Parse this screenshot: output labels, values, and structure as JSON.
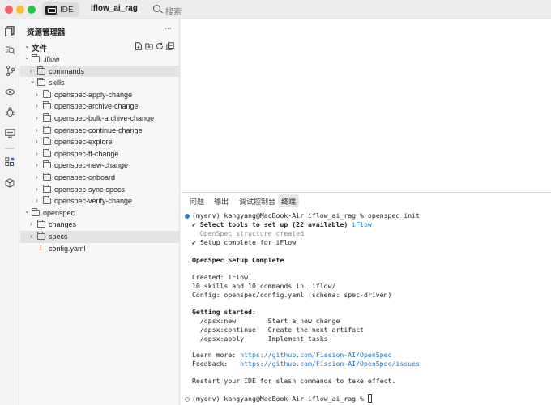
{
  "titlebar": {
    "ide_label": "IDE",
    "project": "iflow_ai_rag",
    "search_placeholder": "搜索"
  },
  "sidebar": {
    "title": "资源管理器",
    "more": "···",
    "section": "文件",
    "tree": [
      {
        "label": ".iflow",
        "depth": 0,
        "expanded": true,
        "type": "folder"
      },
      {
        "label": "commands",
        "depth": 1,
        "expanded": false,
        "type": "folder",
        "selected": true
      },
      {
        "label": "skills",
        "depth": 1,
        "expanded": true,
        "type": "folder"
      },
      {
        "label": "openspec-apply-change",
        "depth": 2,
        "expanded": false,
        "type": "folder"
      },
      {
        "label": "openspec-archive-change",
        "depth": 2,
        "expanded": false,
        "type": "folder"
      },
      {
        "label": "openspec-bulk-archive-change",
        "depth": 2,
        "expanded": false,
        "type": "folder"
      },
      {
        "label": "openspec-continue-change",
        "depth": 2,
        "expanded": false,
        "type": "folder"
      },
      {
        "label": "openspec-explore",
        "depth": 2,
        "expanded": false,
        "type": "folder"
      },
      {
        "label": "openspec-ff-change",
        "depth": 2,
        "expanded": false,
        "type": "folder"
      },
      {
        "label": "openspec-new-change",
        "depth": 2,
        "expanded": false,
        "type": "folder"
      },
      {
        "label": "openspec-onboard",
        "depth": 2,
        "expanded": false,
        "type": "folder"
      },
      {
        "label": "openspec-sync-specs",
        "depth": 2,
        "expanded": false,
        "type": "folder"
      },
      {
        "label": "openspec-verify-change",
        "depth": 2,
        "expanded": false,
        "type": "folder"
      },
      {
        "label": "openspec",
        "depth": 0,
        "expanded": true,
        "type": "folder"
      },
      {
        "label": "changes",
        "depth": 1,
        "expanded": false,
        "type": "folder"
      },
      {
        "label": "specs",
        "depth": 1,
        "expanded": false,
        "type": "folder",
        "selected": true
      },
      {
        "label": "config.yaml",
        "depth": 1,
        "type": "yaml"
      }
    ]
  },
  "panel": {
    "tabs": [
      "问题",
      "输出",
      "调试控制台",
      "终端"
    ],
    "active_tab": "终端"
  },
  "terminal": {
    "prompt1": "(myenv) kangyang@MacBook-Air iflow_ai_rag % openspec init",
    "select_prefix": "✔ Select tools to set up (22 available) ",
    "select_value": "iFlow",
    "structure": "  OpenSpec structure created",
    "setup": "✔ Setup complete for iFlow",
    "heading": "OpenSpec Setup Complete",
    "created": "Created: iFlow",
    "skills": "10 skills and 10 commands in .iflow/",
    "config": "Config: openspec/config.yaml (schema: spec-driven)",
    "getting_started": "Getting started:",
    "cmd1": "  /opsx:new        Start a new change",
    "cmd2": "  /opsx:continue   Create the next artifact",
    "cmd3": "  /opsx:apply      Implement tasks",
    "learn_label": "Learn more: ",
    "learn_url": "https://github.com/Fission-AI/OpenSpec",
    "feedback_label": "Feedback:   ",
    "feedback_url": "https://github.com/Fission-AI/OpenSpec/issues",
    "restart": "Restart your IDE for slash commands to take effect.",
    "prompt2": "(myenv) kangyang@MacBook-Air iflow_ai_rag % "
  },
  "colors": {
    "link": "#1a73c8",
    "accent_dot": "#2c7be5",
    "yaml_icon": "#c0392b"
  }
}
